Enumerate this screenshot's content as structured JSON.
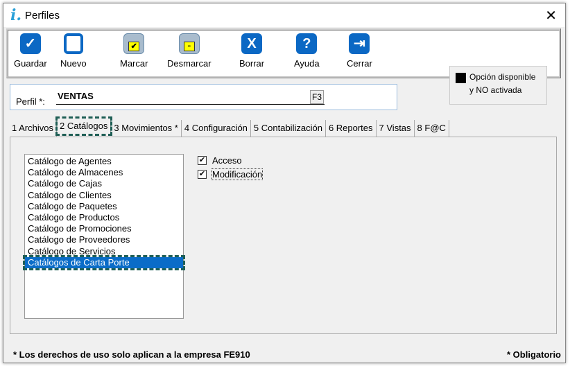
{
  "window": {
    "title": "Perfiles",
    "close": "✕"
  },
  "toolbar": {
    "buttons": [
      {
        "label": "Guardar",
        "glyph": "✓"
      },
      {
        "label": "Nuevo",
        "glyph": ""
      },
      {
        "label": "Marcar",
        "glyph": "✔"
      },
      {
        "label": "Desmarcar",
        "glyph": "▫"
      },
      {
        "label": "Borrar",
        "glyph": "X"
      },
      {
        "label": "Ayuda",
        "glyph": "?"
      },
      {
        "label": "Cerrar",
        "glyph": "⇥"
      }
    ]
  },
  "legend": {
    "text1": "Opción disponible",
    "text2": "y NO activada"
  },
  "perfil": {
    "label": "Perfil *:",
    "value": "VENTAS",
    "f3": "F3"
  },
  "tabs": [
    "1 Archivos",
    "2 Catálogos",
    "3 Movimientos *",
    "4 Configuración",
    "5 Contabilización",
    "6 Reportes",
    "7 Vistas",
    "8 F@C"
  ],
  "list": [
    "Catálogo de Agentes",
    "Catálogo de Almacenes",
    "Catálogo de Cajas",
    "Catálogo de Clientes",
    "Catálogo de Paquetes",
    "Catálogo de Productos",
    "Catálogo de Promociones",
    "Catálogo de Proveedores",
    "Catálogo de Servicios",
    "Catálogos de Carta Porte"
  ],
  "checks": [
    {
      "label": "Acceso",
      "checked": true
    },
    {
      "label": "Modificación",
      "checked": true
    }
  ],
  "footer": {
    "note": "* Los derechos de uso solo aplican a la empresa FE910",
    "required": "* Obligatorio"
  }
}
